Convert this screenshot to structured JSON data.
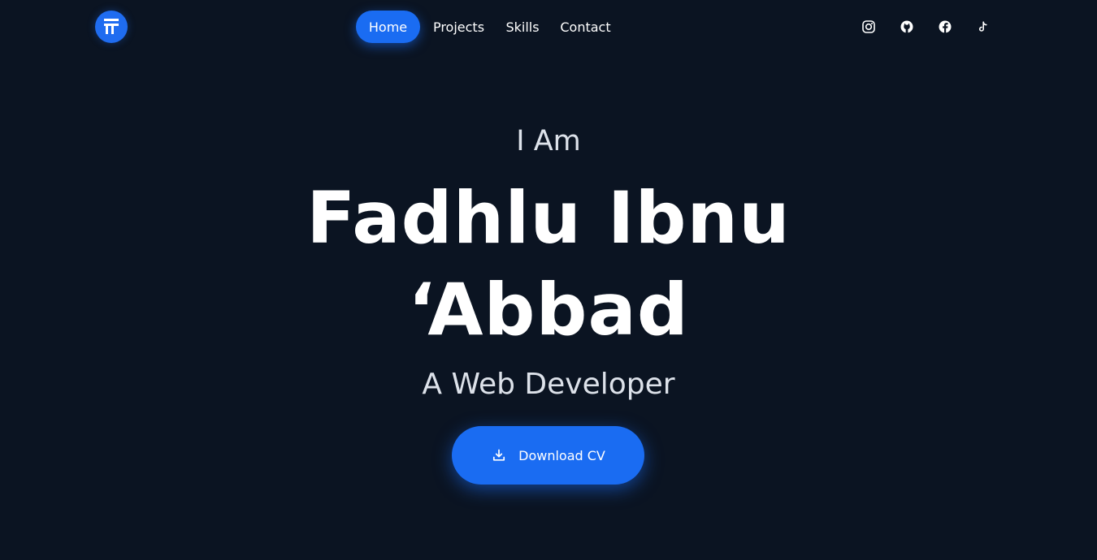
{
  "header": {
    "logo_icon": "brand-logo-icon",
    "nav": [
      {
        "label": "Home",
        "active": true
      },
      {
        "label": "Projects",
        "active": false
      },
      {
        "label": "Skills",
        "active": false
      },
      {
        "label": "Contact",
        "active": false
      }
    ],
    "social": [
      {
        "name": "instagram-icon"
      },
      {
        "name": "github-icon"
      },
      {
        "name": "facebook-icon"
      },
      {
        "name": "tiktok-icon"
      }
    ]
  },
  "hero": {
    "intro": "I Am",
    "name_line1": "Fadhlu Ibnu",
    "name_line2": "‘Abbad",
    "role": "A Web Developer",
    "cta_label": "Download CV",
    "cta_icon": "download-icon"
  },
  "colors": {
    "background": "#0b1422",
    "accent": "#1a6cf2",
    "text": "#ffffff",
    "muted_text": "#dde2ea"
  }
}
